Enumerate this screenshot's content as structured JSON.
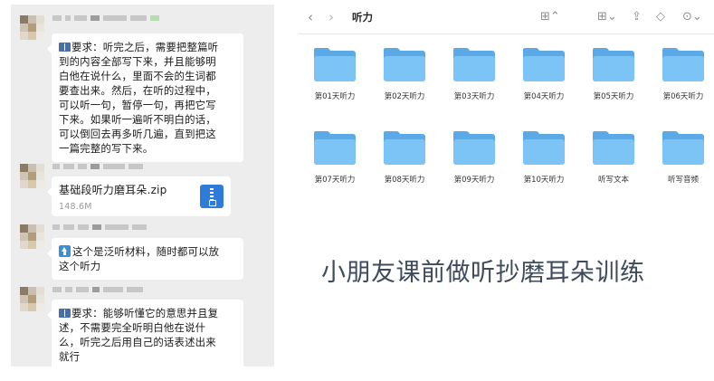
{
  "chat": {
    "messages": [
      {
        "type": "text",
        "icon": "book-icon",
        "text": "📖要求：听完之后，需要把整篇听到的内容全部写下来，并且能够明白他在说什么，里面不会的生词都要查出来。然后，在听的过程中，可以听一句，暂停一句，再把它写下来。如果听一遍听不明白的话，可以倒回去再多听几遍，直到把这一篇完整的写下来。"
      },
      {
        "type": "file",
        "icon": "zip-file-icon",
        "file_name": "基础段听力磨耳朵.zip",
        "file_size": "148.6M"
      },
      {
        "type": "text",
        "icon": "up-arrow-icon",
        "text": "⬆️这个是泛听材料，随时都可以放这个听力"
      },
      {
        "type": "text",
        "icon": "book-icon",
        "text": "📖要求：能够听懂它的意思并且复述，不需要完全听明白他在说什么，听完之后用自己的话表述出来就行"
      }
    ],
    "lines": {
      "m1": [
        "要求：听完之后，需要把整篇听",
        "到的内容全部写下来，并且能够明",
        "白他在说什么，里面不会的生词都",
        "要查出来。然后，在听的过程中，",
        "可以听一句，暂停一句，再把它写",
        "下来。如果听一遍听不明白的话，",
        "可以倒回去再多听几遍，直到把这",
        "一篇完整的写下来。"
      ],
      "m3": [
        "这个是泛听材料，随时都可以放",
        "这个听力"
      ],
      "m4": [
        "要求：能够听懂它的意思并且复",
        "述，不需要完全听明白他在说什",
        "么，听完之后用自己的话表述出来",
        "就行"
      ]
    }
  },
  "finder": {
    "title": "听力",
    "nav": {
      "back_icon": "chevron-left-icon",
      "forward_icon": "chevron-right-icon"
    },
    "toolbar_icons": [
      "grid-view-icon",
      "group-icon",
      "share-icon",
      "tag-icon",
      "more-icon"
    ],
    "folders": [
      "第01天听力",
      "第02天听力",
      "第03天听力",
      "第04天听力",
      "第05天听力",
      "第06天听力",
      "第07天听力",
      "第08天听力",
      "第09天听力",
      "第10天听力",
      "听写文本",
      "听写音频"
    ],
    "folder_color": "#5ba9e6"
  },
  "caption": "小朋友课前做听抄磨耳朵训练"
}
